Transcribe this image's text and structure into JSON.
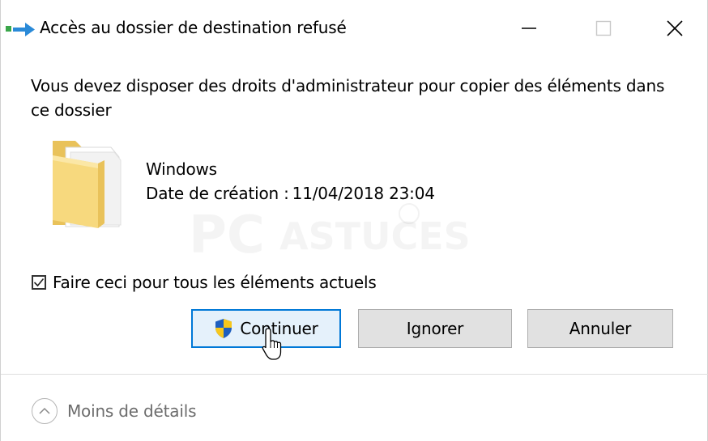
{
  "window": {
    "title": "Accès au dossier de destination refusé",
    "controls": {
      "minimize": "minimize-icon",
      "maximize": "maximize-icon",
      "close": "close-icon"
    }
  },
  "dialog": {
    "message": "Vous devez disposer des droits d'administrateur pour copier des éléments dans ce dossier",
    "item": {
      "icon": "folder-icon",
      "name": "Windows",
      "date_label": "Date de création :",
      "date_value": "11/04/2018 23:04"
    },
    "apply_all": {
      "label": "Faire ceci pour tous les éléments actuels",
      "checked": true
    },
    "buttons": {
      "continue": "Continuer",
      "skip": "Ignorer",
      "cancel": "Annuler"
    },
    "details_toggle": "Moins de détails"
  },
  "watermark": {
    "text_main": "PC",
    "text_secondary": "ASTUCES"
  },
  "colors": {
    "accent": "#0078d7",
    "primary_button_bg": "#e5f1fb",
    "button_bg": "#e1e1e1",
    "folder_yellow": "#f5d77a",
    "shield_blue": "#1f5fbf",
    "shield_yellow": "#f7c71c",
    "muted_text": "#6d6d6d"
  }
}
